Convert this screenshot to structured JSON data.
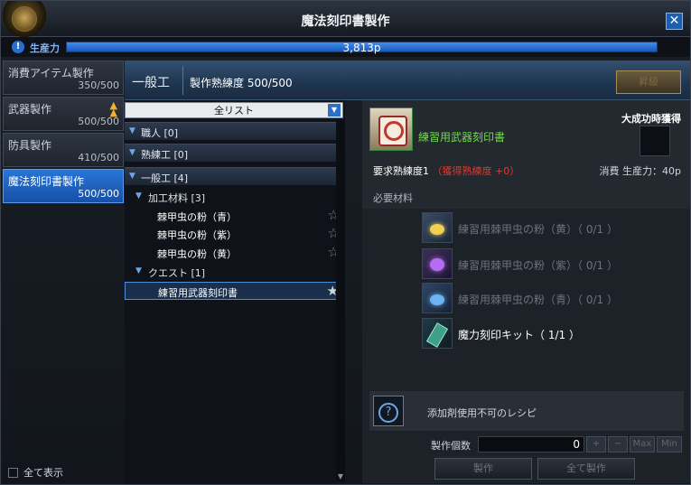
{
  "window": {
    "title": "魔法刻印書製作",
    "close": "✕"
  },
  "productivity": {
    "icon": "!",
    "label": "生産力",
    "value": "3,813p",
    "fill_fraction": 1.0
  },
  "categories": [
    {
      "name": "消費アイテム製作",
      "progress": "350/500",
      "active": false,
      "rank_up": false
    },
    {
      "name": "武器製作",
      "progress": "500/500",
      "active": false,
      "rank_up": true
    },
    {
      "name": "防具製作",
      "progress": "410/500",
      "active": false,
      "rank_up": false
    },
    {
      "name": "魔法刻印書製作",
      "progress": "500/500",
      "active": true,
      "rank_up": false
    }
  ],
  "show_all": {
    "label": "全て表示",
    "checked": false
  },
  "header": {
    "category": "一般工",
    "skill": "製作熟練度 500/500",
    "rank_button": "昇級"
  },
  "recipe_list": {
    "filter": "全リスト",
    "groups": [
      {
        "label": "職人 [0]"
      },
      {
        "label": "熟練工 [0]"
      },
      {
        "label": "一般工 [4]"
      }
    ],
    "subgroups": [
      {
        "label": "加工材料 [3]"
      },
      {
        "label": "クエスト [1]"
      }
    ],
    "items": [
      {
        "label": "棘甲虫の粉（青）",
        "star": "☆",
        "selected": false
      },
      {
        "label": "棘甲虫の粉（紫）",
        "star": "☆",
        "selected": false
      },
      {
        "label": "棘甲虫の粉（黄）",
        "star": "☆",
        "selected": false
      },
      {
        "label": "練習用武器刻印書",
        "star": "★",
        "selected": true
      }
    ]
  },
  "detail": {
    "item_name": "練習用武器刻印書",
    "great_success": "大成功時獲得",
    "required_skill": "要求熟練度1",
    "skill_gain": "（獲得熟練度 +0）",
    "consume": "消費 生産力：40p",
    "materials_title": "必要材料",
    "materials": [
      {
        "name": "練習用棘甲虫の粉（黄）（ 0/1 ）",
        "icon": "yellow-powder-icon",
        "have": false
      },
      {
        "name": "練習用棘甲虫の粉（紫）（ 0/1 ）",
        "icon": "purple-powder-icon",
        "have": false
      },
      {
        "name": "練習用棘甲虫の粉（青）（ 0/1 ）",
        "icon": "blue-powder-icon",
        "have": false
      },
      {
        "name": "魔力刻印キット（ 1/1 ）",
        "icon": "engraving-kit-icon",
        "have": true
      }
    ],
    "additive_text": "添加剤使用不可のレシピ",
    "quantity_label": "製作個数",
    "quantity": "0",
    "qty_buttons": [
      "+",
      "−",
      "Max",
      "Min"
    ],
    "craft": "製作",
    "craft_all": "全て製作"
  },
  "colors": {
    "accent": "#2a75d6",
    "item_name": "#6fdc4b",
    "skill_gain": "#e0392b",
    "rank_up": "#f0b030"
  }
}
